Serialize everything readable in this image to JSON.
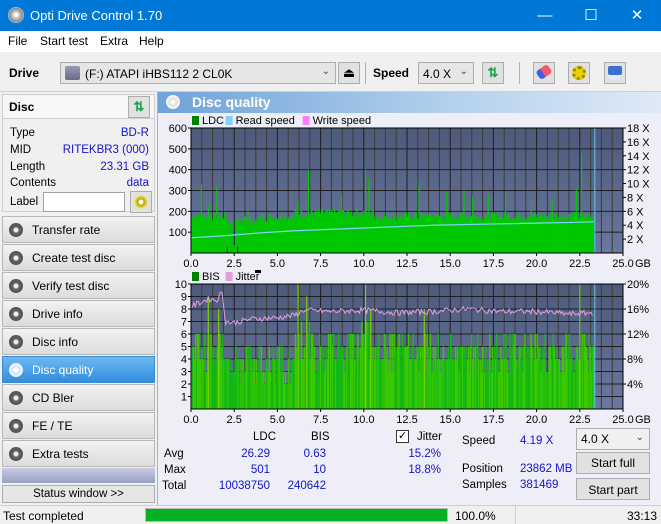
{
  "window": {
    "title": "Opti Drive Control 1.70",
    "minimize": "—",
    "maximize": "☐",
    "close": "✕"
  },
  "menu": [
    "File",
    "Start test",
    "Extra",
    "Help"
  ],
  "toolbar": {
    "drive_label": "Drive",
    "drive_value": "(F:)  ATAPI iHBS112  2 CL0K",
    "speed_label": "Speed",
    "speed_value": "4.0 X",
    "eject_icon": "⏏",
    "refresh_icon": "⇅",
    "eraser_icon": "eraser",
    "settings_icon": "gears",
    "save_icon": "floppy"
  },
  "disc": {
    "header": "Disc",
    "fields": [
      {
        "key": "Type",
        "value": "BD-R"
      },
      {
        "key": "MID",
        "value": "RITEKBR3 (000)"
      },
      {
        "key": "Length",
        "value": "23.31 GB"
      },
      {
        "key": "Contents",
        "value": "data"
      }
    ],
    "label_key": "Label",
    "label_value": ""
  },
  "nav": [
    {
      "label": "Transfer rate",
      "active": false
    },
    {
      "label": "Create test disc",
      "active": false
    },
    {
      "label": "Verify test disc",
      "active": false
    },
    {
      "label": "Drive info",
      "active": false
    },
    {
      "label": "Disc info",
      "active": false
    },
    {
      "label": "Disc quality",
      "active": true
    },
    {
      "label": "CD Bler",
      "active": false
    },
    {
      "label": "FE / TE",
      "active": false
    },
    {
      "label": "Extra tests",
      "active": false
    }
  ],
  "status_window_button": "Status window >>",
  "panel": {
    "title": "Disc quality"
  },
  "chart_data": [
    {
      "type": "area",
      "title": "LDC",
      "legend": [
        "LDC",
        "Read speed",
        "Write speed"
      ],
      "legend_colors": {
        "LDC": "#008000",
        "Read speed": "#87cefa",
        "Write speed": "#ff80ff"
      },
      "xlabel": "GB",
      "x_ticks": [
        "0.0",
        "2.5",
        "5.0",
        "7.5",
        "10.0",
        "12.5",
        "15.0",
        "17.5",
        "20.0",
        "22.5",
        "25.0"
      ],
      "xlim": [
        0,
        25
      ],
      "y_ticks": [
        "100",
        "200",
        "300",
        "400",
        "500",
        "600"
      ],
      "ylim": [
        0,
        600
      ],
      "y2_ticks": [
        "2 X",
        "4 X",
        "6 X",
        "8 X",
        "10 X",
        "12 X",
        "14 X",
        "16 X",
        "18 X"
      ],
      "y2lim": [
        0,
        18
      ],
      "data_end_gb": 23.31,
      "ldc_baseline_segments": [
        {
          "x0": 0.0,
          "x1": 2.0,
          "level": 180
        },
        {
          "x0": 2.0,
          "x1": 4.0,
          "level": 160
        },
        {
          "x0": 4.0,
          "x1": 6.0,
          "level": 175
        },
        {
          "x0": 6.0,
          "x1": 10.5,
          "level": 195
        },
        {
          "x0": 10.5,
          "x1": 23.31,
          "level": 180
        }
      ],
      "ldc_spikes": [
        {
          "x": 0.6,
          "y": 330
        },
        {
          "x": 1.0,
          "y": 230
        },
        {
          "x": 1.5,
          "y": 320
        },
        {
          "x": 2.1,
          "y": 30
        },
        {
          "x": 2.7,
          "y": 30
        },
        {
          "x": 3.3,
          "y": 200
        },
        {
          "x": 6.2,
          "y": 250
        },
        {
          "x": 6.8,
          "y": 400
        },
        {
          "x": 8.7,
          "y": 280
        },
        {
          "x": 10.1,
          "y": 400
        },
        {
          "x": 10.3,
          "y": 360
        },
        {
          "x": 13.2,
          "y": 340
        },
        {
          "x": 14.8,
          "y": 290
        },
        {
          "x": 15.8,
          "y": 300
        },
        {
          "x": 16.3,
          "y": 270
        },
        {
          "x": 17.2,
          "y": 280
        },
        {
          "x": 18.2,
          "y": 290
        },
        {
          "x": 19.7,
          "y": 250
        },
        {
          "x": 20.9,
          "y": 260
        },
        {
          "x": 22.3,
          "y": 310
        },
        {
          "x": 22.6,
          "y": 480
        }
      ],
      "read_speed": [
        [
          0,
          2.2
        ],
        [
          2,
          2.5
        ],
        [
          4,
          2.9
        ],
        [
          6,
          3.2
        ],
        [
          8,
          3.4
        ],
        [
          10,
          3.6
        ],
        [
          12,
          3.8
        ],
        [
          14,
          4.0
        ],
        [
          16,
          4.1
        ],
        [
          18,
          4.2
        ],
        [
          20,
          4.3
        ],
        [
          22,
          4.4
        ],
        [
          23.31,
          4.5
        ]
      ]
    },
    {
      "type": "area",
      "title": "BIS",
      "legend": [
        "BIS",
        "Jitter"
      ],
      "legend_colors": {
        "BIS": "#008000",
        "Jitter": "#e0a0e0"
      },
      "xlabel": "GB",
      "x_ticks": [
        "0.0",
        "2.5",
        "5.0",
        "7.5",
        "10.0",
        "12.5",
        "15.0",
        "17.5",
        "20.0",
        "22.5",
        "25.0"
      ],
      "xlim": [
        0,
        25
      ],
      "y_ticks": [
        "1",
        "2",
        "3",
        "4",
        "5",
        "6",
        "7",
        "8",
        "9",
        "10"
      ],
      "ylim": [
        0,
        10
      ],
      "y2_ticks": [
        "4%",
        "8%",
        "12%",
        "16%",
        "20%"
      ],
      "y2lim": [
        0,
        20
      ],
      "data_end_gb": 23.31,
      "bis_levels": [
        {
          "x0": 0.0,
          "x1": 2.0,
          "level": 5
        },
        {
          "x0": 2.0,
          "x1": 6.0,
          "level": 4
        },
        {
          "x0": 6.0,
          "x1": 7.0,
          "level": 6
        },
        {
          "x0": 7.0,
          "x1": 9.5,
          "level": 5
        },
        {
          "x0": 9.5,
          "x1": 10.5,
          "level": 6
        },
        {
          "x0": 10.5,
          "x1": 23.31,
          "level": 5
        }
      ],
      "bis_spikes": [
        {
          "x": 1.0,
          "y": 9
        },
        {
          "x": 1.6,
          "y": 8
        },
        {
          "x": 6.2,
          "y": 10
        },
        {
          "x": 6.7,
          "y": 9
        },
        {
          "x": 10.1,
          "y": 10
        },
        {
          "x": 10.4,
          "y": 8
        },
        {
          "x": 13.5,
          "y": 8
        },
        {
          "x": 22.5,
          "y": 10
        }
      ],
      "jitter": [
        [
          0,
          16.4
        ],
        [
          0.5,
          17.0
        ],
        [
          1.0,
          17.6
        ],
        [
          1.5,
          17.4
        ],
        [
          1.8,
          18.8
        ],
        [
          2.0,
          14.0
        ],
        [
          2.5,
          13.8
        ],
        [
          3.5,
          14.4
        ],
        [
          5.0,
          14.6
        ],
        [
          6.0,
          15.0
        ],
        [
          6.5,
          15.8
        ],
        [
          8.0,
          15.6
        ],
        [
          10.0,
          15.8
        ],
        [
          12.0,
          15.4
        ],
        [
          14.0,
          15.6
        ],
        [
          16.0,
          16.0
        ],
        [
          18.0,
          15.6
        ],
        [
          20.0,
          15.6
        ],
        [
          22.0,
          15.2
        ],
        [
          23.31,
          15.4
        ]
      ]
    }
  ],
  "stats": {
    "col_ldc": "LDC",
    "col_bis": "BIS",
    "jitter_label": "Jitter",
    "jitter_checked": true,
    "rows": [
      {
        "label": "Avg",
        "ldc": "26.29",
        "bis": "0.63",
        "jitter": "15.2%"
      },
      {
        "label": "Max",
        "ldc": "501",
        "bis": "10",
        "jitter": "18.8%"
      },
      {
        "label": "Total",
        "ldc": "10038750",
        "bis": "240642",
        "jitter": ""
      }
    ],
    "speed_label": "Speed",
    "speed_value": "4.19 X",
    "position_label": "Position",
    "position_value": "23862 MB",
    "samples_label": "Samples",
    "samples_value": "381469",
    "speed_select": "4.0 X",
    "start_full": "Start full",
    "start_part": "Start part"
  },
  "statusbar": {
    "text": "Test completed",
    "progress": 100.0,
    "progress_text": "100.0%",
    "time": "33:13"
  }
}
